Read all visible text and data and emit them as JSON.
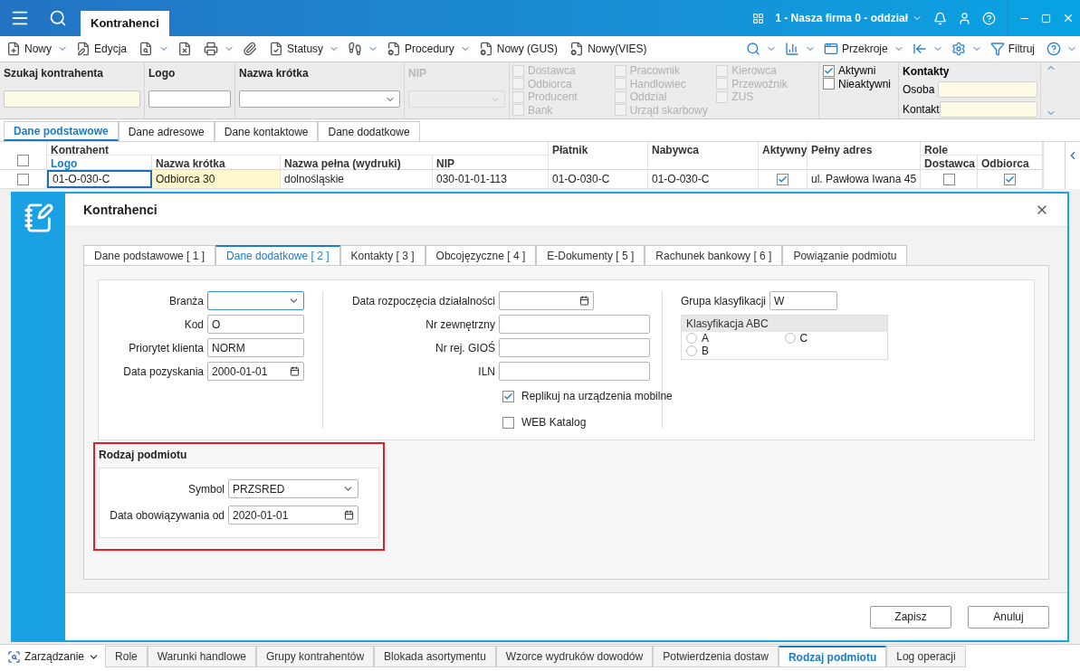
{
  "app": {
    "title_tab": "Kontrahenci",
    "company": "1 - Nasza firma 0 - oddział"
  },
  "toolbar": {
    "left": [
      {
        "label": "Nowy",
        "dropdown": true
      },
      {
        "label": "Edycja",
        "dropdown": false
      },
      {
        "dropdown": true
      },
      {
        "dropdown": false
      },
      {
        "dropdown": true
      },
      {
        "dropdown": false
      },
      {
        "label": "Statusy",
        "dropdown": true
      },
      {
        "dropdown": true
      },
      {
        "label": "Procedury",
        "dropdown": true
      },
      {
        "label": "Nowy (GUS)",
        "dropdown": false
      },
      {
        "label": "Nowy(VIES)",
        "dropdown": false
      }
    ],
    "right": [
      {
        "dropdown": true
      },
      {
        "dropdown": true
      },
      {
        "label": "Przekroje",
        "dropdown": true
      },
      {
        "dropdown": true
      },
      {
        "dropdown": true
      },
      {
        "label": "Filtruj",
        "dropdown": false
      },
      {
        "dropdown": true
      }
    ]
  },
  "filters": {
    "fields": [
      {
        "label": "Szukaj kontrahenta",
        "kind": "search",
        "disabled": false
      },
      {
        "label": "Logo",
        "kind": "text",
        "disabled": false
      },
      {
        "label": "Nazwa krótka",
        "kind": "select",
        "disabled": false
      },
      {
        "label": "NIP",
        "kind": "select",
        "disabled": true
      }
    ],
    "role_columns": [
      {
        "items": [
          {
            "label": "Dostawca",
            "checked": false,
            "disabled": true
          },
          {
            "label": "Odbiorca",
            "checked": false,
            "disabled": true
          },
          {
            "label": "Producent",
            "checked": false,
            "disabled": true
          },
          {
            "label": "Bank",
            "checked": false,
            "disabled": true
          }
        ]
      },
      {
        "items": [
          {
            "label": "Pracownik",
            "checked": false,
            "disabled": true
          },
          {
            "label": "Handlowiec",
            "checked": false,
            "disabled": true
          },
          {
            "label": "Oddział",
            "checked": false,
            "disabled": true
          },
          {
            "label": "Urząd skarbowy",
            "checked": false,
            "disabled": true
          }
        ]
      },
      {
        "items": [
          {
            "label": "Kierowca",
            "checked": false,
            "disabled": true
          },
          {
            "label": "Przewoźnik",
            "checked": false,
            "disabled": true
          },
          {
            "label": "ZUS",
            "checked": false,
            "disabled": true
          }
        ]
      }
    ],
    "status": [
      {
        "label": "Aktywni",
        "checked": true
      },
      {
        "label": "Nieaktywni",
        "checked": false
      }
    ],
    "contacts": {
      "title": "Kontakty",
      "fields": [
        {
          "label": "Osoba"
        },
        {
          "label": "Kontakt"
        }
      ]
    }
  },
  "list_tabs": [
    {
      "label": "Dane podstawowe",
      "selected": true
    },
    {
      "label": "Dane adresowe",
      "selected": false
    },
    {
      "label": "Dane kontaktowe",
      "selected": false
    },
    {
      "label": "Dane dodatkowe",
      "selected": false
    }
  ],
  "table": {
    "column_groups": [
      {
        "label": "Kontrahent"
      },
      {
        "label": "Role"
      }
    ],
    "columns": [
      {
        "label": "Logo",
        "sorted": true,
        "grouped": true
      },
      {
        "label": "Nazwa krótka",
        "sorted": false,
        "grouped": true
      },
      {
        "label": "Nazwa pełna (wydruki)",
        "sorted": false,
        "grouped": true
      },
      {
        "label": "NIP",
        "sorted": false,
        "grouped": true
      },
      {
        "label": "Płatnik",
        "sorted": false,
        "grouped": false
      },
      {
        "label": "Nabywca",
        "sorted": false,
        "grouped": false
      },
      {
        "label": "Aktywny",
        "sorted": false,
        "grouped": false
      },
      {
        "label": "Pełny adres",
        "sorted": false,
        "grouped": false
      },
      {
        "label": "Dostawca",
        "sorted": false,
        "grouped": true
      },
      {
        "label": "Odbiorca",
        "sorted": false,
        "grouped": true
      }
    ],
    "rows": [
      {
        "selected": false,
        "cells": [
          {
            "kind": "text",
            "text": "01-O-030-C"
          },
          {
            "kind": "text",
            "text": "Odbiorca 30"
          },
          {
            "kind": "text",
            "text": "dolnośląskie"
          },
          {
            "kind": "text",
            "text": "030-01-01-113"
          },
          {
            "kind": "text",
            "text": "01-O-030-C"
          },
          {
            "kind": "text",
            "text": "01-O-030-C"
          },
          {
            "kind": "check",
            "checked": true
          },
          {
            "kind": "text",
            "text": "ul. Pawłowa Iwana 45"
          },
          {
            "kind": "check",
            "checked": false
          },
          {
            "kind": "check",
            "checked": true
          }
        ]
      }
    ]
  },
  "dialog": {
    "title": "Kontrahenci",
    "tabs": [
      {
        "label": "Dane podstawowe [ 1 ]",
        "selected": false
      },
      {
        "label": "Dane dodatkowe [ 2 ]",
        "selected": true
      },
      {
        "label": "Kontakty [ 3 ]",
        "selected": false
      },
      {
        "label": "Obcojęzyczne [ 4 ]",
        "selected": false
      },
      {
        "label": "E-Dokumenty [ 5 ]",
        "selected": false
      },
      {
        "label": "Rachunek bankowy [ 6 ]",
        "selected": false
      },
      {
        "label": "Powiązanie podmiotu",
        "selected": false
      }
    ],
    "col1": [
      {
        "label": "Branża",
        "kind": "select"
      },
      {
        "label": "Kod",
        "kind": "text",
        "value": "O"
      },
      {
        "label": "Priorytet klienta",
        "kind": "text",
        "value": "NORM"
      },
      {
        "label": "Data pozyskania",
        "kind": "date",
        "value": "2000-01-01"
      }
    ],
    "col2": [
      {
        "label": "Data rozpoczęcia działalności",
        "kind": "date"
      },
      {
        "label": "Nr zewnętrzny",
        "kind": "text"
      },
      {
        "label": "Nr rej. GIOŚ",
        "kind": "text"
      },
      {
        "label": "ILN",
        "kind": "text"
      },
      {
        "label": "Replikuj na urządzenia mobilne",
        "kind": "checkbox",
        "checked": true
      },
      {
        "label": "WEB Katalog",
        "kind": "checkbox",
        "checked": false
      }
    ],
    "classification": {
      "group_label": "Grupa klasyfikacji",
      "group_value": "W",
      "abc_title": "Klasyfikacja ABC",
      "options": [
        {
          "label": "A",
          "selected": false
        },
        {
          "label": "C",
          "selected": false
        },
        {
          "label": "B",
          "selected": false
        }
      ]
    },
    "entity_type": {
      "title": "Rodzaj podmiotu",
      "highlighted": true,
      "fields": [
        {
          "label": "Symbol",
          "kind": "select",
          "value": "PRZSRED"
        },
        {
          "label": "Data obowiązywania od",
          "kind": "date",
          "value": "2020-01-01"
        }
      ]
    },
    "buttons": [
      "Zapisz",
      "Anuluj"
    ]
  },
  "bottom": {
    "menu": "Zarządzanie",
    "tabs": [
      {
        "label": "Role",
        "selected": false
      },
      {
        "label": "Warunki handlowe",
        "selected": false
      },
      {
        "label": "Grupy kontrahentów",
        "selected": false
      },
      {
        "label": "Blokada asortymentu",
        "selected": false
      },
      {
        "label": "Wzorce wydruków dowodów",
        "selected": false
      },
      {
        "label": "Potwierdzenia dostaw",
        "selected": false
      },
      {
        "label": "Rodzaj podmiotu",
        "selected": true
      },
      {
        "label": "Log operacji",
        "selected": false
      }
    ]
  }
}
